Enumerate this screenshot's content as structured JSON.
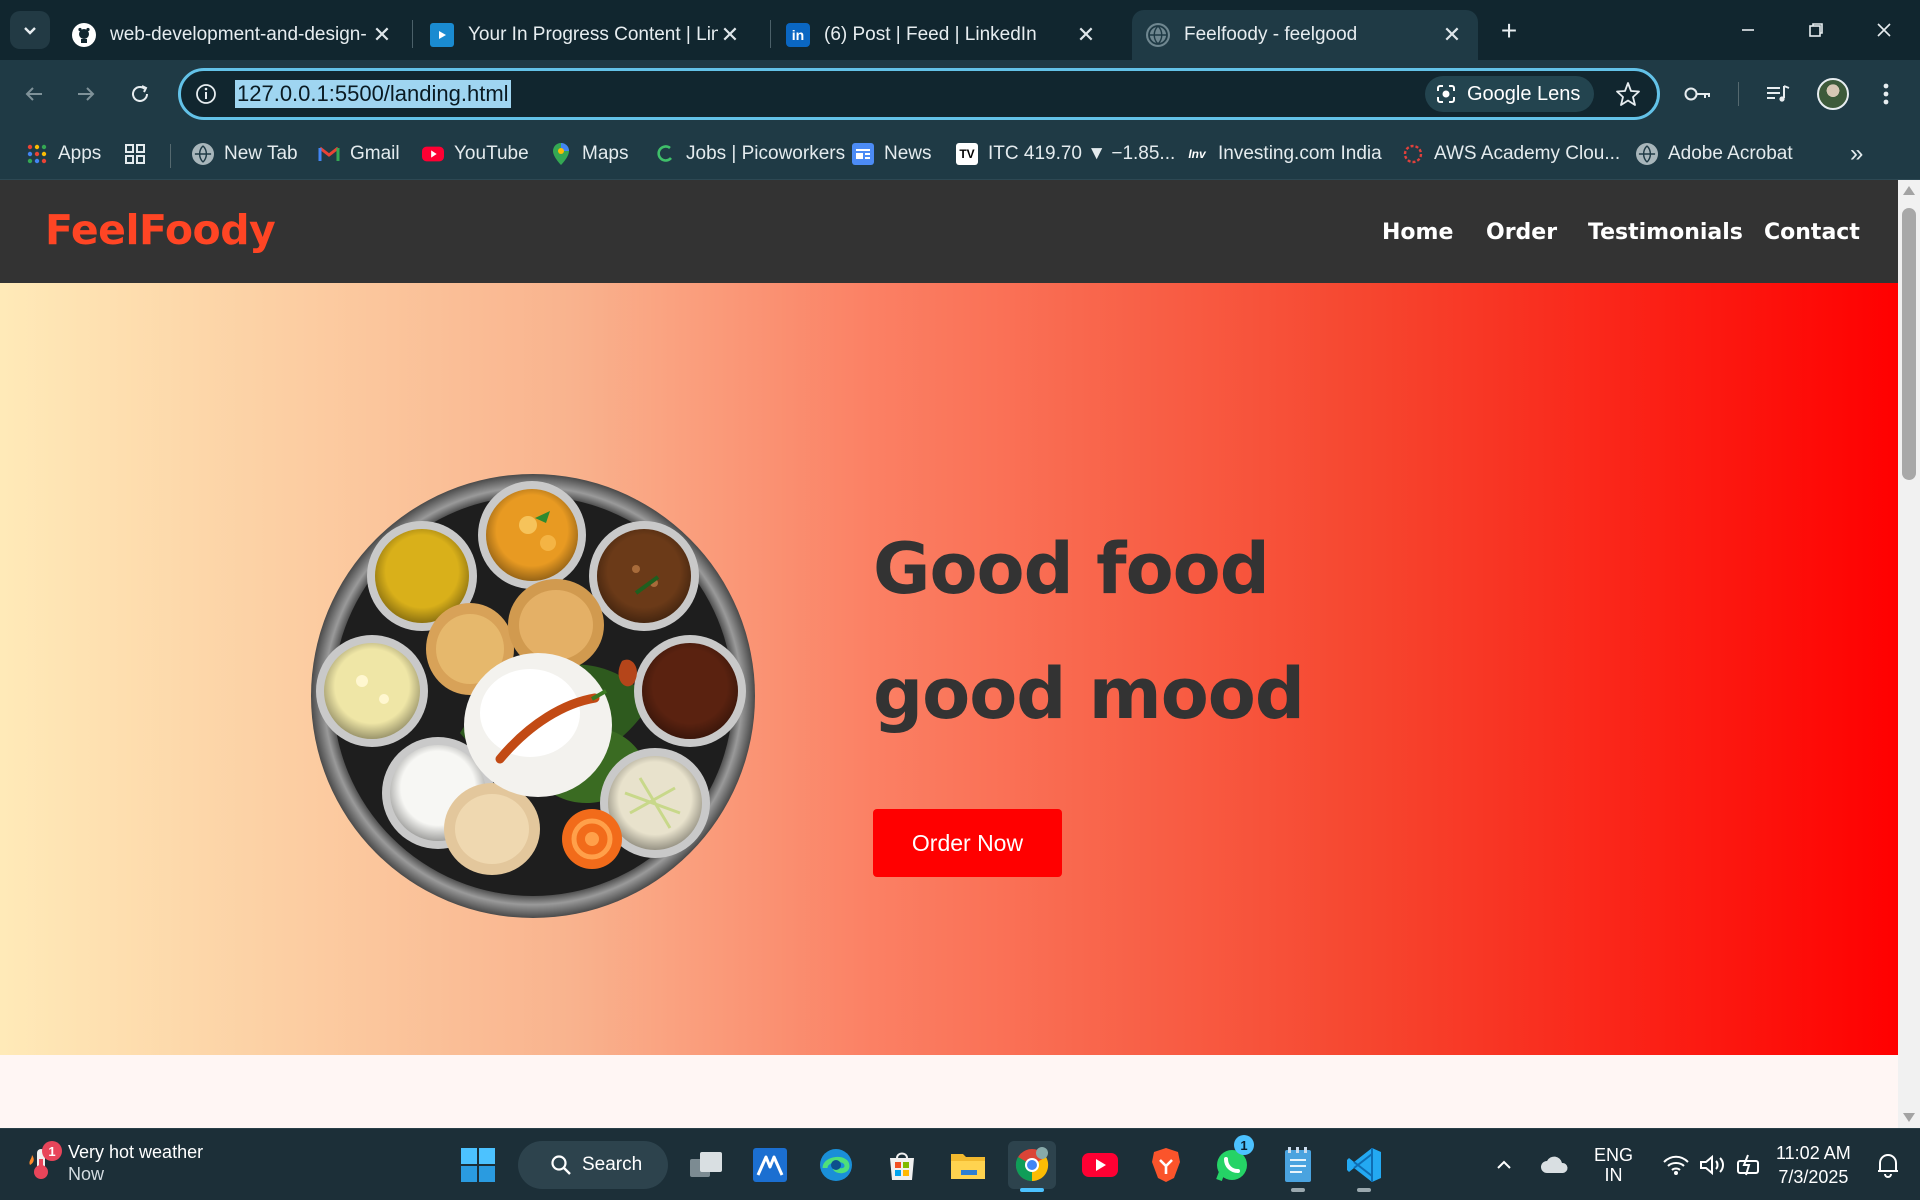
{
  "browser": {
    "tabs": [
      {
        "title": "web-development-and-design-",
        "favicon": "github-icon"
      },
      {
        "title": "Your In Progress Content | Linke",
        "favicon": "linkedin-learning-icon"
      },
      {
        "title": "(6) Post | Feed | LinkedIn",
        "favicon": "linkedin-icon"
      },
      {
        "title": "Feelfoody - feelgood",
        "favicon": "globe-icon",
        "active": true
      }
    ],
    "url": "127.0.0.1:5500/landing.html",
    "lens_label": "Google Lens",
    "bookmarks": [
      {
        "label": "Apps",
        "icon": "apps-grid-icon"
      },
      {
        "label": "New Tab",
        "icon": "globe-icon"
      },
      {
        "label": "Gmail",
        "icon": "gmail-icon"
      },
      {
        "label": "YouTube",
        "icon": "youtube-icon"
      },
      {
        "label": "Maps",
        "icon": "maps-icon"
      },
      {
        "label": "Jobs | Picoworkers",
        "icon": "picoworkers-icon"
      },
      {
        "label": "News",
        "icon": "news-icon"
      },
      {
        "label": "ITC 419.70 ▼ −1.85...",
        "icon": "tradingview-icon"
      },
      {
        "label": "Investing.com India",
        "icon": "investing-icon"
      },
      {
        "label": "AWS Academy Clou...",
        "icon": "aws-academy-icon"
      },
      {
        "label": "Adobe Acrobat",
        "icon": "globe-icon"
      }
    ]
  },
  "site": {
    "brand": "FeelFoody",
    "nav": [
      "Home",
      "Order",
      "Testimonials",
      "Contact"
    ],
    "hero": {
      "headline_line1": "Good food",
      "headline_line2": "good mood",
      "cta": "Order Now"
    }
  },
  "taskbar": {
    "weather_title": "Very hot weather",
    "weather_sub": "Now",
    "weather_badge": "1",
    "search_label": "Search",
    "whatsapp_badge": "1",
    "lang_line1": "ENG",
    "lang_line2": "IN",
    "time": "11:02 AM",
    "date": "7/3/2025"
  },
  "colors": {
    "brand_accent": "#ff4524",
    "cta_red": "#ff0000",
    "header_bg": "#333333",
    "chrome_bg": "#1f3a45"
  }
}
